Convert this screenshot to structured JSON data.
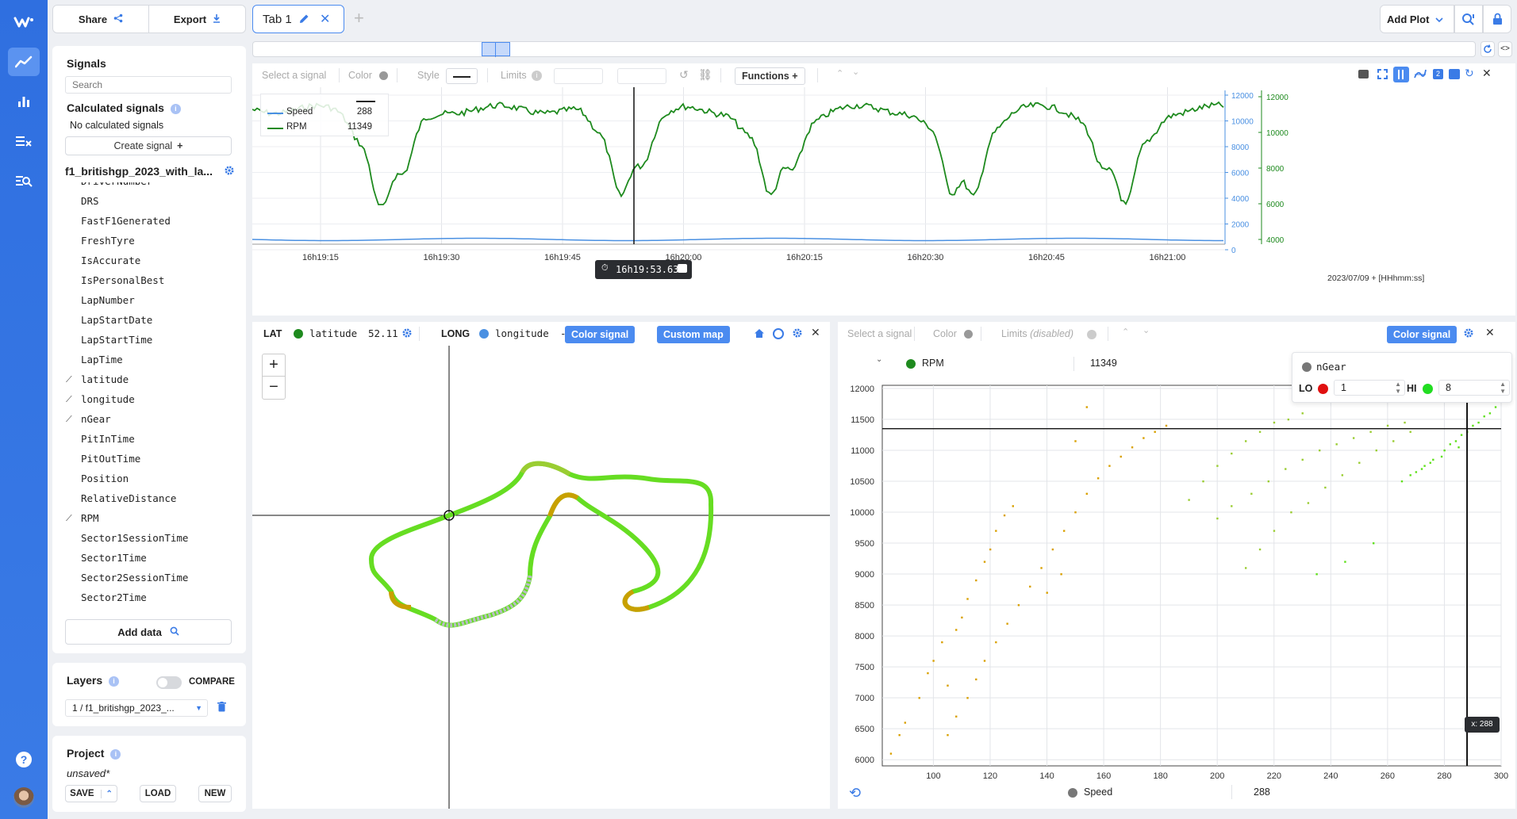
{
  "header": {
    "share_label": "Share",
    "export_label": "Export",
    "tab_label": "Tab 1",
    "add_plot_label": "Add Plot"
  },
  "sidebar": {
    "signals_title": "Signals",
    "search_placeholder": "Search",
    "calc_title": "Calculated signals",
    "calc_empty": "No calculated signals",
    "create_signal_label": "Create signal",
    "dataset_name": "f1_britishgp_2023_with_la...",
    "signals": [
      {
        "label": "DriverNumber",
        "plotted": false
      },
      {
        "label": "DRS",
        "plotted": false
      },
      {
        "label": "FastF1Generated",
        "plotted": false
      },
      {
        "label": "FreshTyre",
        "plotted": false
      },
      {
        "label": "IsAccurate",
        "plotted": false
      },
      {
        "label": "IsPersonalBest",
        "plotted": false
      },
      {
        "label": "LapNumber",
        "plotted": false
      },
      {
        "label": "LapStartDate",
        "plotted": false
      },
      {
        "label": "LapStartTime",
        "plotted": false
      },
      {
        "label": "LapTime",
        "plotted": false
      },
      {
        "label": "latitude",
        "plotted": true
      },
      {
        "label": "longitude",
        "plotted": true
      },
      {
        "label": "nGear",
        "plotted": true
      },
      {
        "label": "PitInTime",
        "plotted": false
      },
      {
        "label": "PitOutTime",
        "plotted": false
      },
      {
        "label": "Position",
        "plotted": false
      },
      {
        "label": "RelativeDistance",
        "plotted": false
      },
      {
        "label": "RPM",
        "plotted": true
      },
      {
        "label": "Sector1SessionTime",
        "plotted": false
      },
      {
        "label": "Sector1Time",
        "plotted": false
      },
      {
        "label": "Sector2SessionTime",
        "plotted": false
      },
      {
        "label": "Sector2Time",
        "plotted": false
      }
    ],
    "add_data_label": "Add data",
    "layers_title": "Layers",
    "compare_label": "COMPARE",
    "layer_select": "1 / f1_britishgp_2023_...",
    "project_title": "Project",
    "project_state": "unsaved*",
    "save_label": "SAVE",
    "load_label": "LOAD",
    "new_label": "NEW"
  },
  "timeplot": {
    "toolbar": {
      "select_signal": "Select a signal",
      "color": "Color",
      "style": "Style",
      "limits": "Limits",
      "functions": "Functions"
    },
    "legend": [
      {
        "name": "Speed",
        "value": "288",
        "color": "#4a90e2"
      },
      {
        "name": "RPM",
        "value": "11349",
        "color": "#1e8a1e"
      }
    ],
    "cursor_time": "16h19:53.633",
    "date_format": "2023/07/09 + [HHhmm:ss]",
    "x_ticks": [
      "16h19:15",
      "16h19:30",
      "16h19:45",
      "16h20:00",
      "16h20:15",
      "16h20:30",
      "16h20:45",
      "16h21:00"
    ],
    "speed_axis_ticks": [
      "12000",
      "10000",
      "8000",
      "6000",
      "4000",
      "2000",
      "0"
    ],
    "rpm_axis_ticks": [
      "12000",
      "10000",
      "8000",
      "6000",
      "4000"
    ]
  },
  "map": {
    "lat_label": "LAT",
    "lat_signal": "latitude",
    "lat_value": "52.11",
    "long_label": "LONG",
    "long_signal": "longitude",
    "long_value": "-",
    "color_signal_label": "Color signal",
    "custom_map_label": "Custom map",
    "zoom_in": "+",
    "zoom_out": "−"
  },
  "scatter": {
    "toolbar": {
      "select_signal": "Select a signal",
      "color": "Color",
      "limits": "Limits",
      "limits_note": "(disabled)",
      "color_signal_label": "Color signal"
    },
    "y_signal": "RPM",
    "y_value": "11349",
    "x_signal": "Speed",
    "x_value": "288",
    "color_popup": {
      "signal": "nGear",
      "lo_label": "LO",
      "lo_value": "1",
      "lo_color": "#e01010",
      "hi_label": "HI",
      "hi_value": "8",
      "hi_color": "#22dd22"
    },
    "x_cursor_label": "x: 288"
  },
  "chart_data": {
    "type": "scatter",
    "title": "",
    "xlabel": "Speed",
    "ylabel": "RPM",
    "xlim": [
      82,
      300
    ],
    "ylim": [
      5900,
      12050
    ],
    "x_ticks": [
      100,
      120,
      140,
      160,
      180,
      200,
      220,
      240,
      260,
      280,
      300
    ],
    "y_ticks": [
      6000,
      6500,
      7000,
      7500,
      8000,
      8500,
      9000,
      9500,
      10000,
      10500,
      11000,
      11500,
      12000
    ],
    "cursor": {
      "x": 288,
      "y": 11349
    },
    "series": [
      {
        "name": "",
        "color": "#d9a000",
        "values": [
          [
            85,
            6100
          ],
          [
            88,
            6400
          ],
          [
            90,
            6600
          ],
          [
            95,
            7000
          ],
          [
            98,
            7400
          ],
          [
            100,
            7600
          ],
          [
            103,
            7900
          ],
          [
            105,
            7200
          ],
          [
            108,
            8100
          ],
          [
            110,
            8300
          ],
          [
            112,
            8600
          ],
          [
            115,
            8900
          ],
          [
            118,
            9200
          ],
          [
            120,
            9400
          ],
          [
            122,
            9700
          ],
          [
            125,
            9950
          ],
          [
            128,
            10100
          ],
          [
            105,
            6400
          ],
          [
            108,
            6700
          ],
          [
            112,
            7000
          ],
          [
            115,
            7300
          ],
          [
            118,
            7600
          ],
          [
            122,
            7900
          ],
          [
            126,
            8200
          ],
          [
            130,
            8500
          ],
          [
            134,
            8800
          ],
          [
            138,
            9100
          ],
          [
            142,
            9400
          ],
          [
            146,
            9700
          ],
          [
            150,
            10000
          ],
          [
            154,
            10300
          ],
          [
            158,
            10550
          ],
          [
            162,
            10750
          ],
          [
            166,
            10900
          ],
          [
            170,
            11050
          ],
          [
            174,
            11200
          ],
          [
            178,
            11300
          ],
          [
            182,
            11400
          ],
          [
            150,
            11150
          ],
          [
            154,
            11700
          ],
          [
            140,
            8700
          ],
          [
            145,
            9000
          ]
        ]
      },
      {
        "name": "",
        "color": "#9acd32",
        "values": [
          [
            190,
            10200
          ],
          [
            195,
            10500
          ],
          [
            200,
            10750
          ],
          [
            205,
            10950
          ],
          [
            210,
            11150
          ],
          [
            215,
            11300
          ],
          [
            220,
            11450
          ],
          [
            225,
            11500
          ],
          [
            230,
            11600
          ],
          [
            200,
            9900
          ],
          [
            205,
            10100
          ],
          [
            212,
            10300
          ],
          [
            218,
            10500
          ],
          [
            224,
            10700
          ],
          [
            230,
            10850
          ],
          [
            236,
            11000
          ],
          [
            242,
            11100
          ],
          [
            248,
            11200
          ],
          [
            254,
            11300
          ],
          [
            260,
            11400
          ],
          [
            266,
            11450
          ],
          [
            210,
            9100
          ],
          [
            215,
            9400
          ],
          [
            220,
            9700
          ],
          [
            226,
            10000
          ],
          [
            232,
            10150
          ],
          [
            238,
            10400
          ],
          [
            244,
            10600
          ],
          [
            250,
            10800
          ],
          [
            256,
            11000
          ],
          [
            262,
            11150
          ],
          [
            268,
            11300
          ]
        ]
      },
      {
        "name": "",
        "color": "#5fe01a",
        "values": [
          [
            265,
            10500
          ],
          [
            268,
            10600
          ],
          [
            272,
            10700
          ],
          [
            276,
            10850
          ],
          [
            280,
            11000
          ],
          [
            284,
            11150
          ],
          [
            288,
            11300
          ],
          [
            292,
            11450
          ],
          [
            296,
            11600
          ],
          [
            298,
            11700
          ],
          [
            270,
            10650
          ],
          [
            275,
            10800
          ],
          [
            282,
            11100
          ],
          [
            286,
            11250
          ],
          [
            290,
            11400
          ],
          [
            294,
            11550
          ],
          [
            285,
            11050
          ],
          [
            279,
            10900
          ],
          [
            273,
            10750
          ],
          [
            235,
            9000
          ],
          [
            245,
            9200
          ],
          [
            255,
            9500
          ]
        ]
      }
    ]
  }
}
